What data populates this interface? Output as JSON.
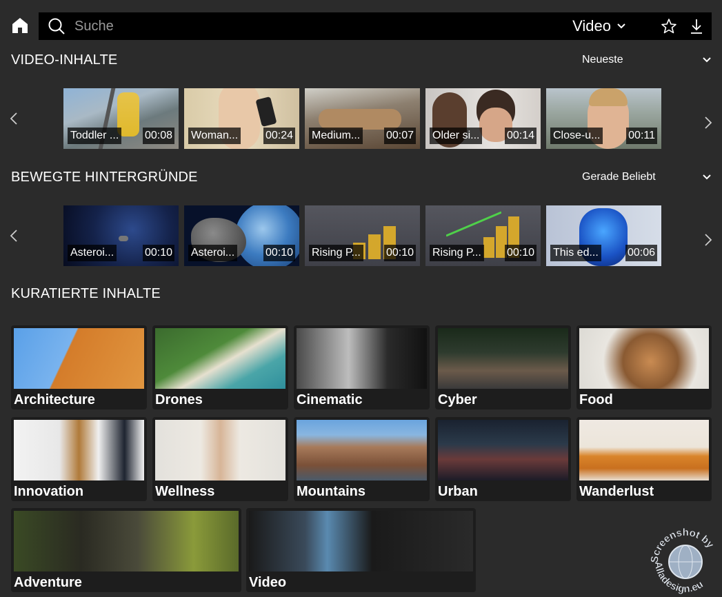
{
  "header": {
    "search_placeholder": "Suche",
    "media_type": "Video"
  },
  "sections": {
    "videos": {
      "title": "VIDEO-INHALTE",
      "sort": "Neueste",
      "items": [
        {
          "caption": "Toddler ...",
          "duration": "00:08"
        },
        {
          "caption": "Woman...",
          "duration": "00:24"
        },
        {
          "caption": "Medium...",
          "duration": "00:07"
        },
        {
          "caption": "Older si...",
          "duration": "00:14"
        },
        {
          "caption": "Close-u...",
          "duration": "00:11"
        }
      ]
    },
    "backgrounds": {
      "title": "BEWEGTE HINTERGRÜNDE",
      "sort": "Gerade Beliebt",
      "items": [
        {
          "caption": "Asteroi...",
          "duration": "00:10"
        },
        {
          "caption": "Asteroi...",
          "duration": "00:10"
        },
        {
          "caption": "Rising P...",
          "duration": "00:10"
        },
        {
          "caption": "Rising P...",
          "duration": "00:10"
        },
        {
          "caption": "This ed...",
          "duration": "00:06"
        }
      ]
    },
    "curated": {
      "title": "KURATIERTE INHALTE",
      "items": [
        {
          "label": "Architecture"
        },
        {
          "label": "Drones"
        },
        {
          "label": "Cinematic"
        },
        {
          "label": "Cyber"
        },
        {
          "label": "Food"
        },
        {
          "label": "Innovation"
        },
        {
          "label": "Wellness"
        },
        {
          "label": "Mountains"
        },
        {
          "label": "Urban"
        },
        {
          "label": "Wanderlust"
        },
        {
          "label": "Adventure"
        },
        {
          "label": "Video"
        }
      ]
    }
  },
  "watermark": {
    "line1": "Screenshot by",
    "line2": "Alladesign.eu"
  },
  "colors": {
    "background": "#2b2b2b",
    "search_bar": "#000000",
    "tile": "#1d1d1d",
    "text": "#ffffff"
  }
}
